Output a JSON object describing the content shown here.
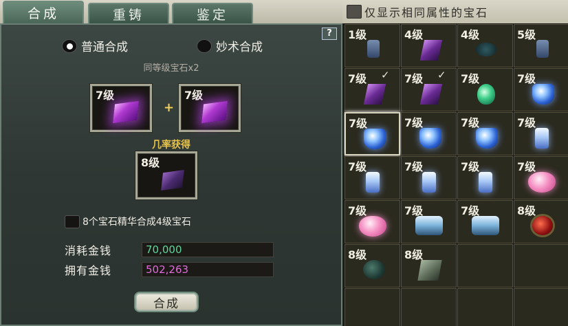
{
  "tabs": [
    "合成",
    "重铸",
    "鉴定"
  ],
  "help_label": "?",
  "modes": {
    "normal": "普通合成",
    "special": "妙术合成"
  },
  "hint": "同等级宝石x2",
  "inputs": [
    {
      "level": "7级"
    },
    {
      "level": "7级"
    }
  ],
  "plus": "+",
  "chance_label": "几率获得",
  "output": {
    "level": "8级"
  },
  "essence_option": "8个宝石精华合成4级宝石",
  "cost_label": "消耗金钱",
  "cost_value": "70,000",
  "owned_label": "拥有金钱",
  "owned_value": "502,263",
  "compose_button": "合成",
  "filter_label": "仅显示相同属性的宝石",
  "inventory": [
    {
      "level": "1级",
      "icon": "blue-dim",
      "checked": ""
    },
    {
      "level": "4级",
      "icon": "purple",
      "checked": ""
    },
    {
      "level": "4级",
      "icon": "teal-dark",
      "checked": ""
    },
    {
      "level": "5级",
      "icon": "blue-dim",
      "checked": ""
    },
    {
      "level": "7级",
      "icon": "purple",
      "checked": "✓"
    },
    {
      "level": "7级",
      "icon": "purple",
      "checked": "✓"
    },
    {
      "level": "7级",
      "icon": "green",
      "checked": ""
    },
    {
      "level": "7级",
      "icon": "blue",
      "checked": ""
    },
    {
      "level": "7级",
      "icon": "blue",
      "checked": "",
      "selected": true
    },
    {
      "level": "7级",
      "icon": "blue",
      "checked": ""
    },
    {
      "level": "7级",
      "icon": "blue",
      "checked": ""
    },
    {
      "level": "7级",
      "icon": "crystal",
      "checked": ""
    },
    {
      "level": "7级",
      "icon": "crystal",
      "checked": ""
    },
    {
      "level": "7级",
      "icon": "crystal",
      "checked": ""
    },
    {
      "level": "7级",
      "icon": "crystal",
      "checked": ""
    },
    {
      "level": "7级",
      "icon": "pink",
      "checked": ""
    },
    {
      "level": "7级",
      "icon": "pink",
      "checked": ""
    },
    {
      "level": "7级",
      "icon": "chest",
      "checked": ""
    },
    {
      "level": "7级",
      "icon": "chest",
      "checked": ""
    },
    {
      "level": "8级",
      "icon": "red",
      "checked": ""
    },
    {
      "level": "8级",
      "icon": "dark-green",
      "checked": ""
    },
    {
      "level": "8级",
      "icon": "gray",
      "checked": ""
    },
    {
      "level": "",
      "icon": "",
      "checked": ""
    },
    {
      "level": "",
      "icon": "",
      "checked": ""
    },
    {
      "level": "",
      "icon": "",
      "checked": ""
    },
    {
      "level": "",
      "icon": "",
      "checked": ""
    },
    {
      "level": "",
      "icon": "",
      "checked": ""
    },
    {
      "level": "",
      "icon": "",
      "checked": ""
    }
  ]
}
